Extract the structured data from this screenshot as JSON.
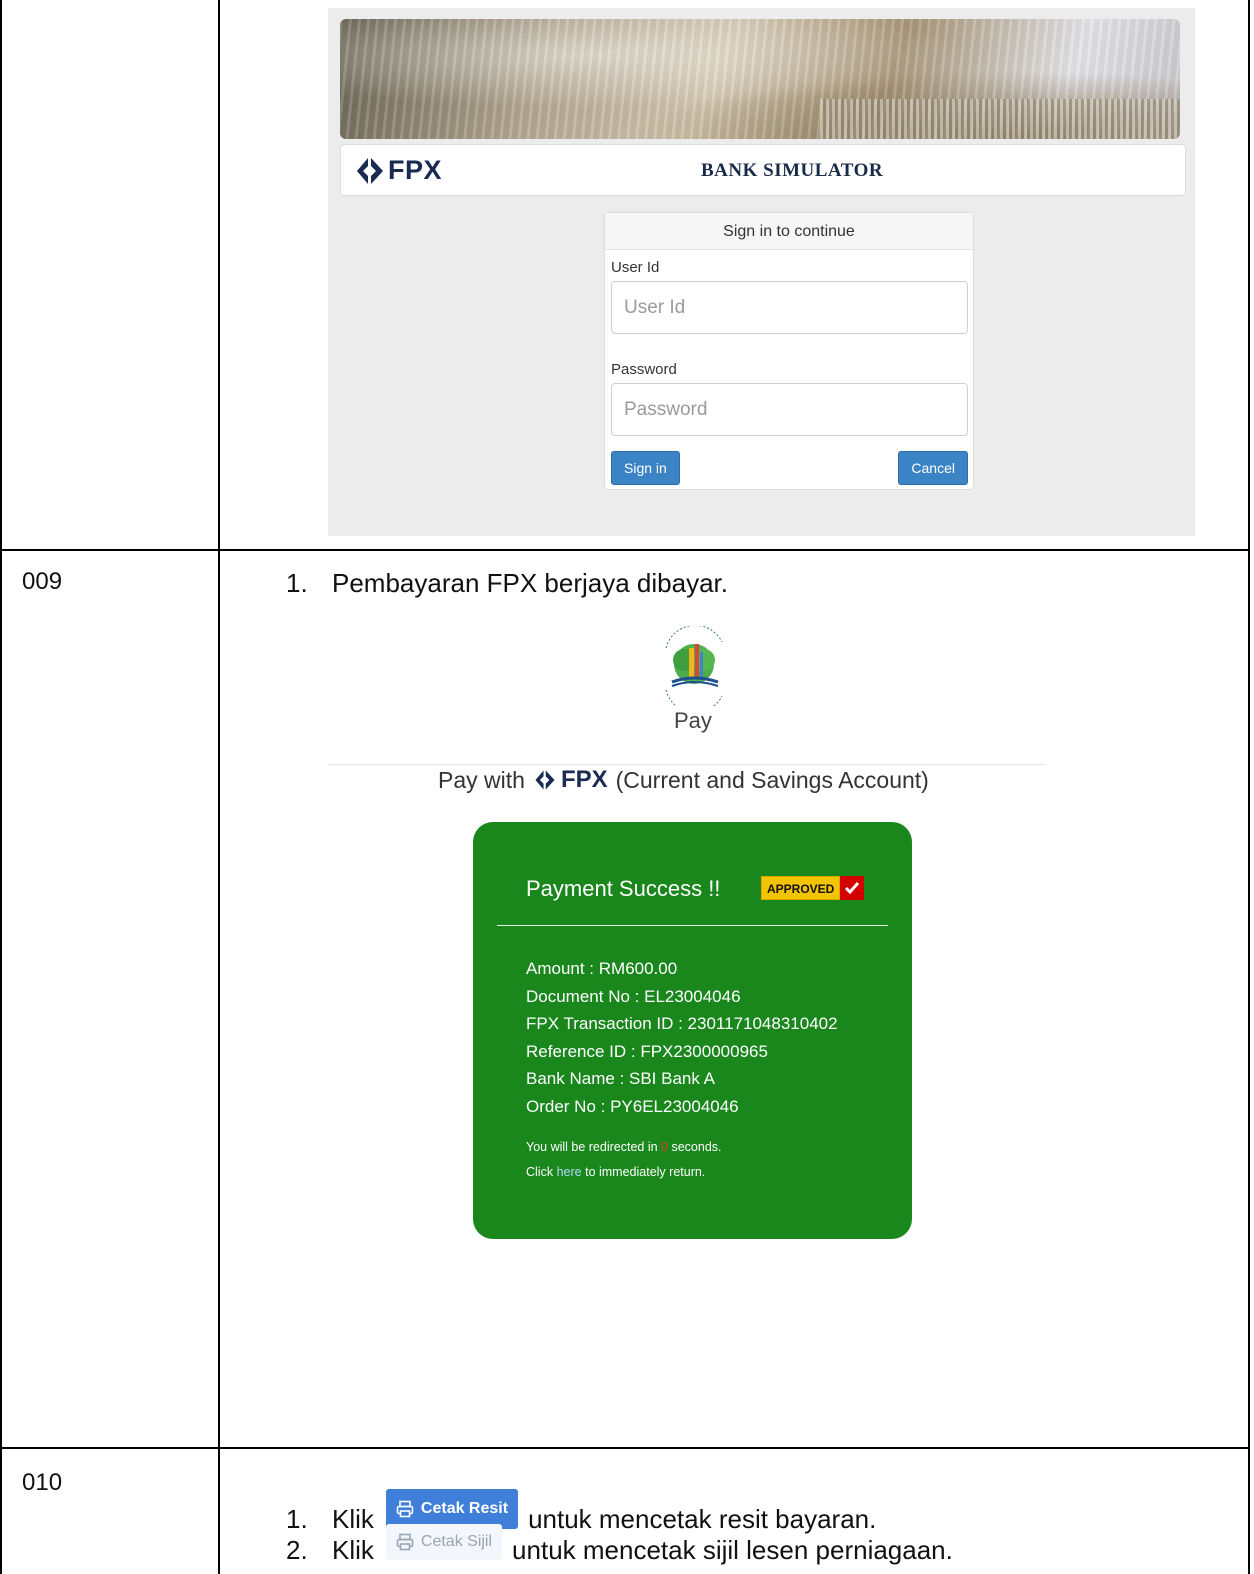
{
  "bank_simulator": {
    "logo_text": "FPX",
    "title": "BANK SIMULATOR",
    "panel_heading": "Sign in to continue",
    "user_id_label": "User Id",
    "user_id_placeholder": "User Id",
    "password_label": "Password",
    "password_placeholder": "Password",
    "sign_in_label": "Sign in",
    "cancel_label": "Cancel"
  },
  "row_009": {
    "id": "009",
    "step_number": "1.",
    "step_text": "Pembayaran FPX berjaya dibayar.",
    "logo_caption": "Pay",
    "pay_with_prefix": "Pay with",
    "pay_with_logo": "FPX",
    "pay_with_suffix": "(Current and Savings Account)",
    "success": {
      "title": "Payment Success !!",
      "badge": "APPROVED",
      "amount": "Amount : RM600.00",
      "document_no": "Document No : EL23004046",
      "fpx_txn_id": "FPX Transaction ID : 2301171048310402",
      "reference_id": "Reference ID : FPX2300000965",
      "bank_name": "Bank Name : SBI Bank A",
      "order_no": "Order No : PY6EL23004046",
      "redirect_prefix": "You will be redirected in",
      "redirect_count": "0",
      "redirect_suffix": "seconds.",
      "click_prefix": "Click",
      "click_link": "here",
      "click_suffix": "to immediately return."
    }
  },
  "row_010": {
    "id": "010",
    "step1_number": "1.",
    "step1_prefix": "Klik",
    "step1_button": "Cetak Resit",
    "step1_suffix": "untuk mencetak resit bayaran.",
    "step2_number": "2.",
    "step2_prefix": "Klik",
    "step2_button": "Cetak Sijil",
    "step2_suffix": "untuk mencetak sijil lesen perniagaan."
  },
  "colors": {
    "table_border": "#000000",
    "success_green": "#1a871d",
    "button_blue": "#3a84c5",
    "fpx_navy": "#1a2b52"
  },
  "icons": [
    "fpx-chevron-icon",
    "perbadanan-putrajaya-logo",
    "checkmark-icon",
    "printer-icon"
  ]
}
